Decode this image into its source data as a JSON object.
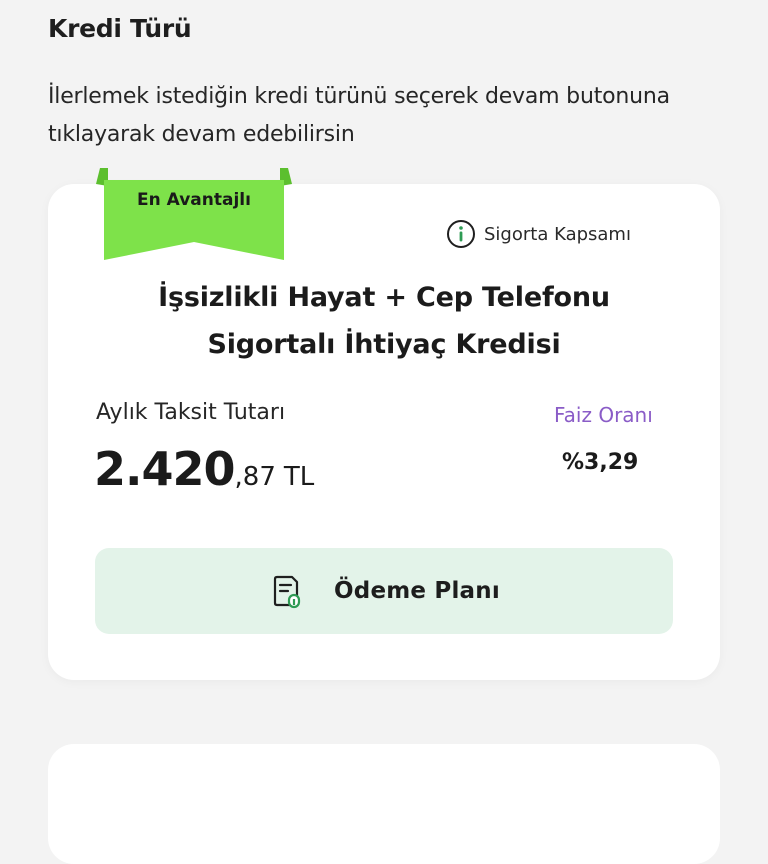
{
  "header": {
    "title": "Kredi Türü",
    "description": "İlerlemek istediğin kredi türünü seçerek devam butonuna tıklayarak devam edebilirsin"
  },
  "card": {
    "badge": "En Avantajlı",
    "insurance_link": "Sigorta Kapsamı",
    "insurance_icon": "info-icon",
    "title_line1": "İşsizlikli Hayat + Cep Telefonu",
    "title_line2": "Sigortalı İhtiyaç Kredisi",
    "installment_label": "Aylık Taksit Tutarı",
    "amount_main": "2.420",
    "amount_decimal": ",87",
    "amount_currency": "TL",
    "rate_label": "Faiz Oranı",
    "rate_value": "%3,29",
    "payment_plan_label": "Ödeme Planı",
    "payment_plan_icon": "document-plan-icon"
  },
  "colors": {
    "badge": "#7ee24a",
    "badge_dark": "#5cbf2e",
    "accent_green": "#2e9b54",
    "rate_label": "#8a5cc7",
    "button_bg": "#e3f3e9"
  }
}
